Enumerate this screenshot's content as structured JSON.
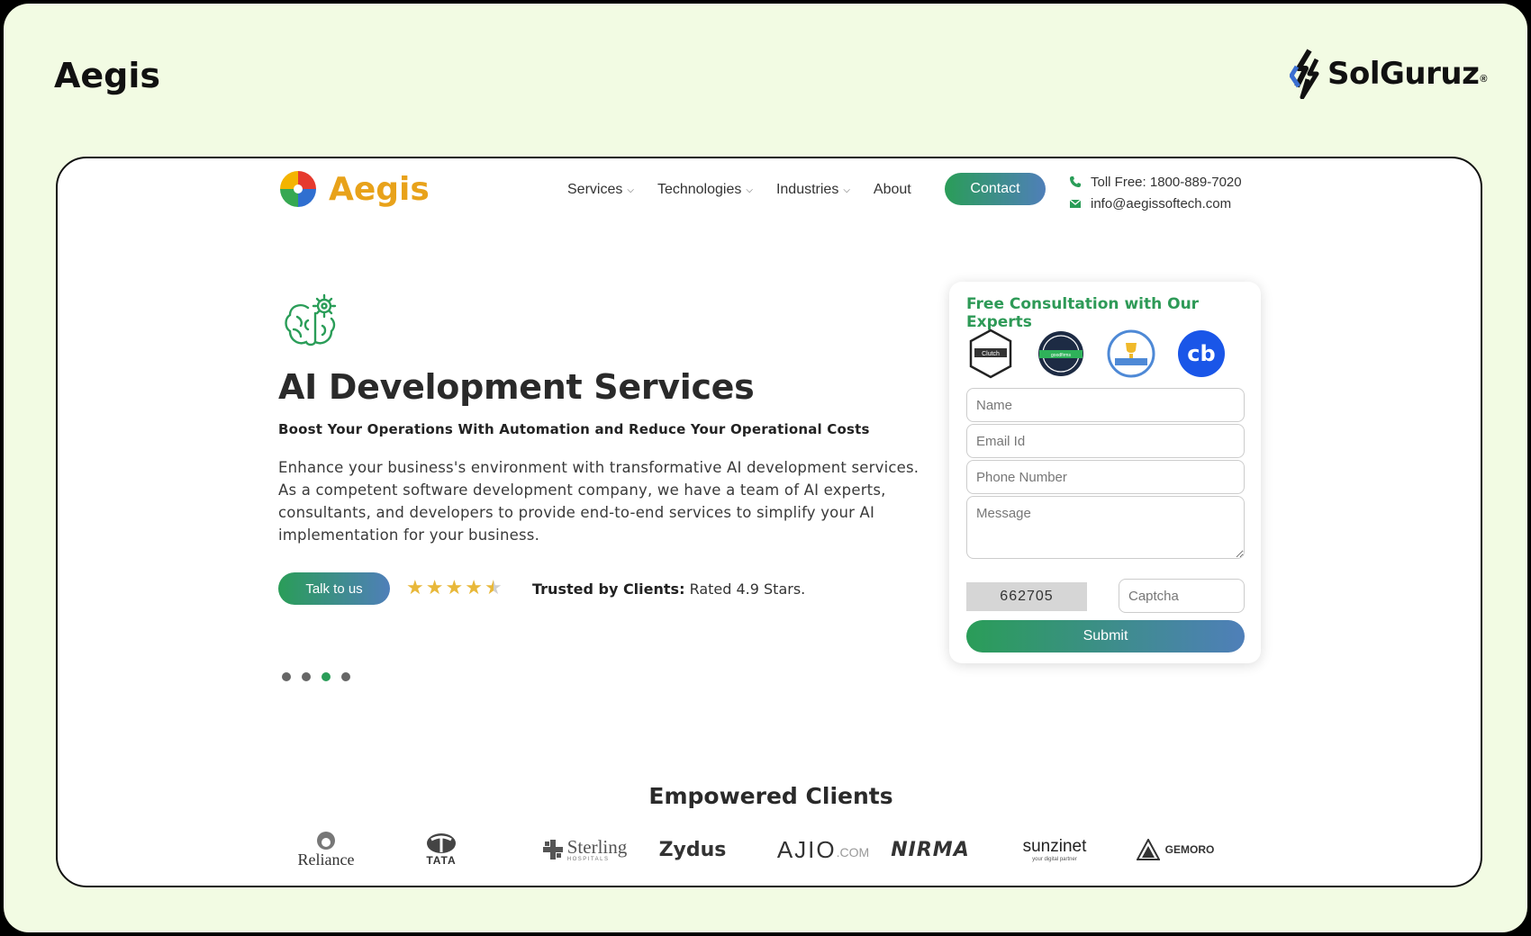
{
  "outer": {
    "title": "Aegis",
    "brand_name": "SolGuruz",
    "brand_mark": "®"
  },
  "site": {
    "logo_text": "Aegis",
    "nav": [
      {
        "label": "Services",
        "has_dropdown": true
      },
      {
        "label": "Technologies",
        "has_dropdown": true
      },
      {
        "label": "Industries",
        "has_dropdown": true
      },
      {
        "label": "About",
        "has_dropdown": false
      }
    ],
    "contact_button": "Contact",
    "toll_free": "Toll Free: 1800-889-7020",
    "email": "info@aegissoftech.com"
  },
  "hero": {
    "icon": "brain-gear-icon",
    "title": "AI Development Services",
    "subtitle": "Boost Your Operations With Automation and Reduce Your Operational Costs",
    "description": "Enhance your business's environment with transformative AI development services. As a competent software development company, we have a team of AI experts, consultants, and developers to provide end-to-end services to simplify your AI implementation for your business.",
    "cta": "Talk to us",
    "stars": 4.5,
    "trusted_label": "Trusted by Clients:",
    "trusted_text": "Rated 4.9 Stars.",
    "slides": 4,
    "active_slide": 3
  },
  "form": {
    "title": "Free Consultation with Our Experts",
    "badges": [
      "Clutch",
      "goodfirms",
      "top-developers",
      "cb"
    ],
    "name_placeholder": "Name",
    "email_placeholder": "Email Id",
    "phone_placeholder": "Phone Number",
    "message_placeholder": "Message",
    "captcha_code": "662705",
    "captcha_placeholder": "Captcha",
    "submit": "Submit"
  },
  "clients": {
    "title": "Empowered Clients",
    "logos": [
      "Reliance",
      "TATA",
      "Sterling",
      "HOSPITALS",
      "Zydus",
      "AJIO",
      ".COM",
      "NIRMA",
      "sunzinet",
      "your digital partner",
      "GEMORO"
    ]
  },
  "colors": {
    "accent_green": "#2a9d58",
    "accent_blue": "#4f7fb9",
    "outer_bg": "#f2fbe3"
  }
}
